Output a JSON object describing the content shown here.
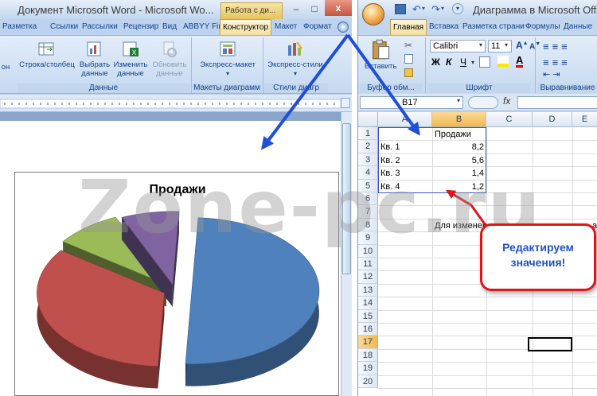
{
  "word": {
    "title": "Документ Microsoft Word - Microsoft Wo...",
    "context_tab": "Работа с ди...",
    "window_buttons": {
      "minimize": "–",
      "maximize": "□",
      "close": "x"
    },
    "tabs": [
      "Разметка",
      "Ссылки",
      "Рассылки",
      "Рецензир",
      "Вид",
      "ABBYY Fin",
      "Конструктор",
      "Макет",
      "Формат"
    ],
    "active_tab": "Конструктор",
    "ribbon": {
      "cut_left_label": "он",
      "row_col_label": "Строка/столбец",
      "select_data_label": "Выбрать данные",
      "edit_data_label": "Изменить данные",
      "refresh_data_label": "Обновить данные",
      "express_layout_label": "Экспресс-макет",
      "express_style_label": "Экспресс-стили",
      "group_data": "Данные",
      "group_layouts": "Макеты диаграмм",
      "group_styles": "Стили диагр"
    },
    "chart_title": "Продажи"
  },
  "excel": {
    "title": "Диаграмма в Microsoft Offi",
    "tabs": [
      "Главная",
      "Вставка",
      "Разметка страни",
      "Формулы",
      "Данные"
    ],
    "active_tab": "Главная",
    "ribbon": {
      "paste_label": "Вставить",
      "clipboard_group": "Буфер обм...",
      "font_name": "Calibri",
      "font_size": "11",
      "bold": "Ж",
      "italic": "К",
      "underline": "Ч",
      "font_group": "Шрифт",
      "align_group": "Выравнивание"
    },
    "name_box": "B17",
    "fx_label": "fx",
    "columns": [
      "A",
      "B",
      "C",
      "D",
      "E"
    ],
    "rows": [
      "1",
      "2",
      "3",
      "4",
      "5",
      "6",
      "7",
      "8",
      "9",
      "10",
      "11",
      "12",
      "13",
      "14",
      "15",
      "16",
      "17",
      "18",
      "19",
      "20"
    ],
    "cells": {
      "b1": "Продажи",
      "a2": "Кв. 1",
      "b2": "8,2",
      "a3": "Кв. 2",
      "b3": "5,6",
      "a4": "Кв. 3",
      "b4": "1,4",
      "a5": "Кв. 4",
      "b5": "1,2",
      "b8": "Для изменен",
      "e8": "а"
    }
  },
  "callout": {
    "line1": "Редактируем",
    "line2": "значения!"
  },
  "watermark": "Zone-pc.ru",
  "chart_data": {
    "type": "pie",
    "title": "Продажи",
    "categories": [
      "Кв. 1",
      "Кв. 2",
      "Кв. 3",
      "Кв. 4"
    ],
    "values": [
      8.2,
      5.6,
      1.4,
      1.2
    ],
    "colors": [
      "#4f81bd",
      "#c0504d",
      "#9bbb59",
      "#8064a2"
    ],
    "style": "3d-exploded"
  },
  "colors": {
    "accent_red": "#e0151a",
    "arrow_blue": "#1f4fd8",
    "callout_text": "#2053c6"
  }
}
